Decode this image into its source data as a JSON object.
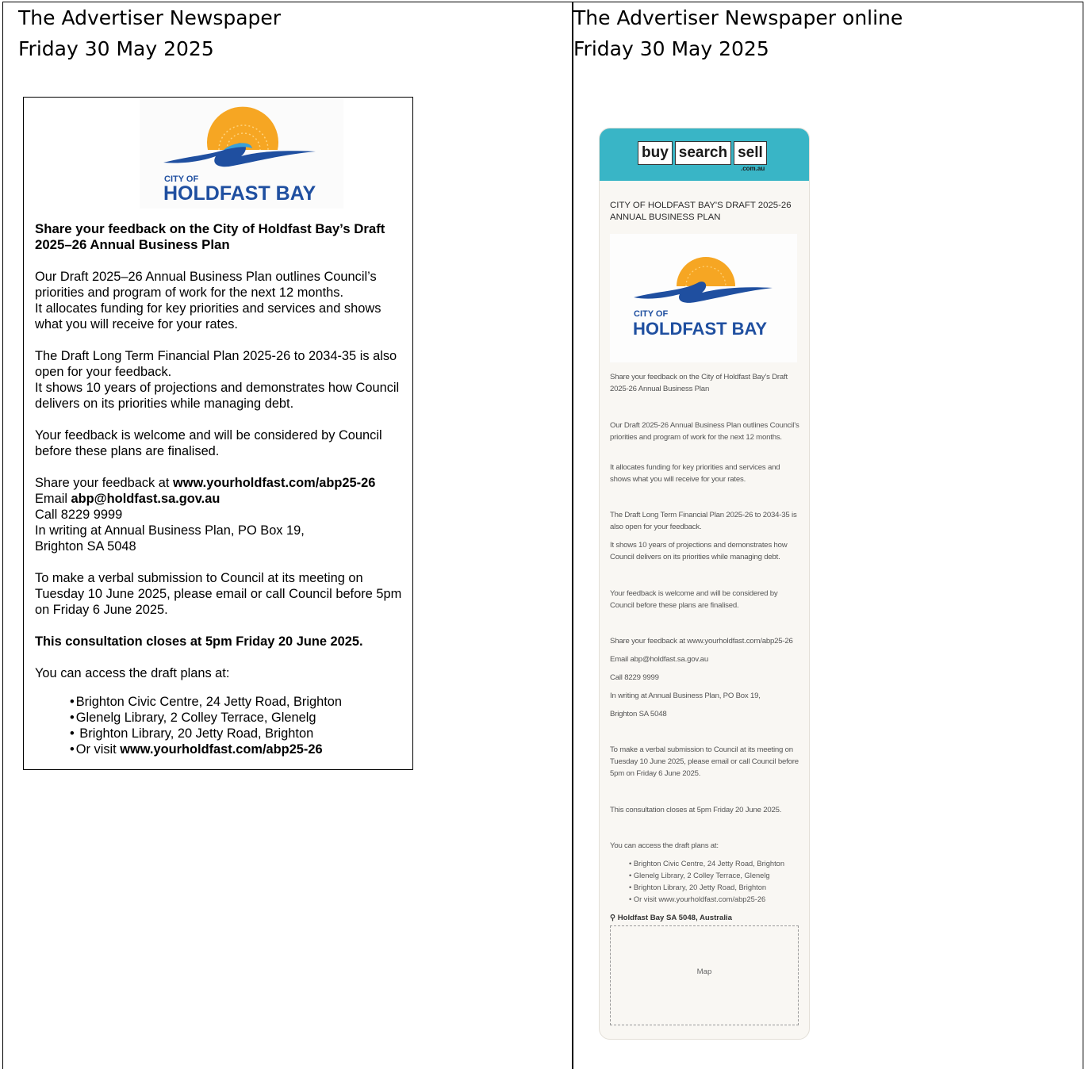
{
  "left_header": {
    "line1": "The Advertiser Newspaper",
    "line2": "Friday 30 May 2025"
  },
  "right_header": {
    "line1": "The Advertiser Newspaper online",
    "line2": "Friday 30 May 2025"
  },
  "logo": {
    "city_of": "CITY OF",
    "name": "HOLDFAST BAY",
    "sun_color": "#f6a623",
    "wave_color": "#1f4fa0"
  },
  "print_ad": {
    "title": "Share your feedback on the City of Holdfast Bay’s Draft 2025–26 Annual Business Plan",
    "p1a": "Our Draft 2025–26 Annual Business Plan outlines Council’s priorities and program of work for the next 12 months.",
    "p1b": "It allocates funding for key priorities and services and shows what you will receive for your rates.",
    "p2a": "The Draft Long Term Financial Plan 2025-26 to 2034-35 is also open for your feedback.",
    "p2b": "It shows 10 years of projections and demonstrates how Council delivers on its priorities while managing debt.",
    "p3": "Your feedback is welcome and will be considered by Council before these plans are finalised.",
    "share_prefix": "Share your feedback at ",
    "share_url": "www.yourholdfast.com/abp25-26",
    "email_prefix": "Email ",
    "email": "abp@holdfast.sa.gov.au",
    "call": "Call 8229 9999",
    "writing1": "In writing at Annual Business Plan, PO Box 19,",
    "writing2": "Brighton SA 5048",
    "verbal": "To make a verbal submission to Council at its meeting on Tuesday 10 June 2025, please email or call Council before 5pm on Friday 6 June 2025.",
    "closes": "This consultation closes at 5pm Friday 20 June 2025.",
    "access": "You can access the draft plans at:",
    "list": [
      "Brighton Civic Centre, 24 Jetty Road, Brighton",
      "Glenelg Library, 2 Colley Terrace, Glenelg",
      " Brighton Library, 20 Jetty Road, Brighton"
    ],
    "visit_prefix": "Or visit ",
    "visit_url": "www.yourholdfast.com/abp25-26"
  },
  "online_card": {
    "brand": [
      "buy",
      "search",
      "sell"
    ],
    "brand_sub": ".com.au",
    "title": "CITY OF HOLDFAST BAY'S DRAFT 2025-26 ANNUAL BUSINESS PLAN",
    "l_share_title": "Share your feedback on the City of Holdfast Bay’s Draft 2025-26 Annual Business Plan",
    "l_p1a": "Our Draft 2025-26 Annual Business Plan outlines Council’s priorities and program of work for the next 12 months.",
    "l_p1b": "It allocates funding for key priorities and services and shows what you will receive for your rates.",
    "l_p2a": "The Draft Long Term Financial Plan 2025-26 to 2034-35 is also open for your feedback.",
    "l_p2b": "It shows 10 years of projections and demonstrates how Council delivers on its priorities while managing debt.",
    "l_p3": "Your feedback is welcome and will be considered by Council before these plans are finalised.",
    "l_share": "Share your feedback at www.yourholdfast.com/abp25-26",
    "l_email": "Email abp@holdfast.sa.gov.au",
    "l_call": "Call 8229 9999",
    "l_writing1": "In writing at Annual Business Plan, PO Box 19,",
    "l_writing2": "Brighton SA 5048",
    "l_verbal": "To make a verbal submission to Council at its meeting on Tuesday 10 June 2025, please email or call Council before 5pm on Friday 6 June 2025.",
    "l_closes": "This consultation closes at 5pm Friday 20 June 2025.",
    "l_access": "You can access the draft plans at:",
    "list": [
      "Brighton Civic Centre, 24 Jetty Road, Brighton",
      "Glenelg Library, 2 Colley Terrace, Glenelg",
      "Brighton Library, 20 Jetty Road, Brighton",
      "Or visit www.yourholdfast.com/abp25-26"
    ],
    "location": "Holdfast Bay SA 5048, Australia",
    "map_label": "Map",
    "accent_color": "#39b5c6"
  }
}
